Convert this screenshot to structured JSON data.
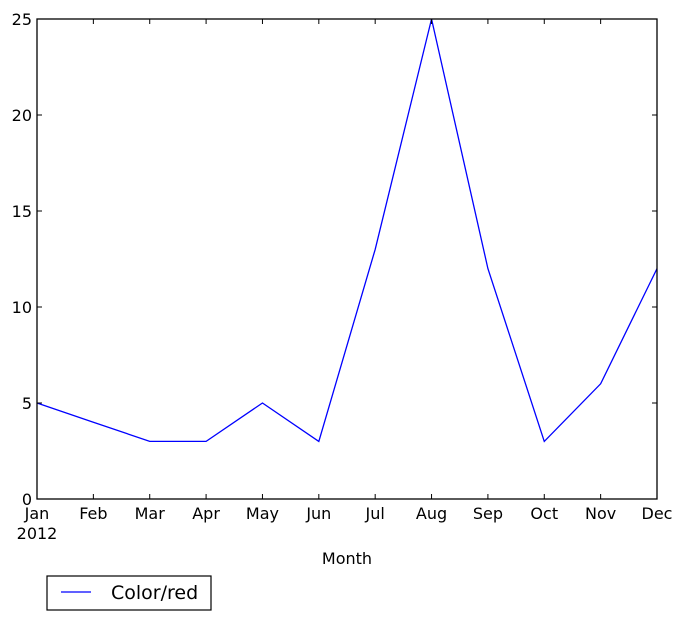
{
  "chart_data": {
    "type": "line",
    "title": "",
    "xlabel": "Month",
    "ylabel": "",
    "categories": [
      "Jan",
      "Feb",
      "Mar",
      "Apr",
      "May",
      "Jun",
      "Jul",
      "Aug",
      "Sep",
      "Oct",
      "Nov",
      "Dec"
    ],
    "x_sublabel": "2012",
    "series": [
      {
        "name": "Color/red",
        "color": "#0000ff",
        "values": [
          5,
          4,
          3,
          3,
          5,
          3,
          13,
          25,
          12,
          3,
          6,
          12
        ]
      }
    ],
    "ylim": [
      0,
      25
    ],
    "yticks": [
      0,
      5,
      10,
      15,
      20,
      25
    ],
    "grid": false,
    "legend_position": "below-left"
  }
}
